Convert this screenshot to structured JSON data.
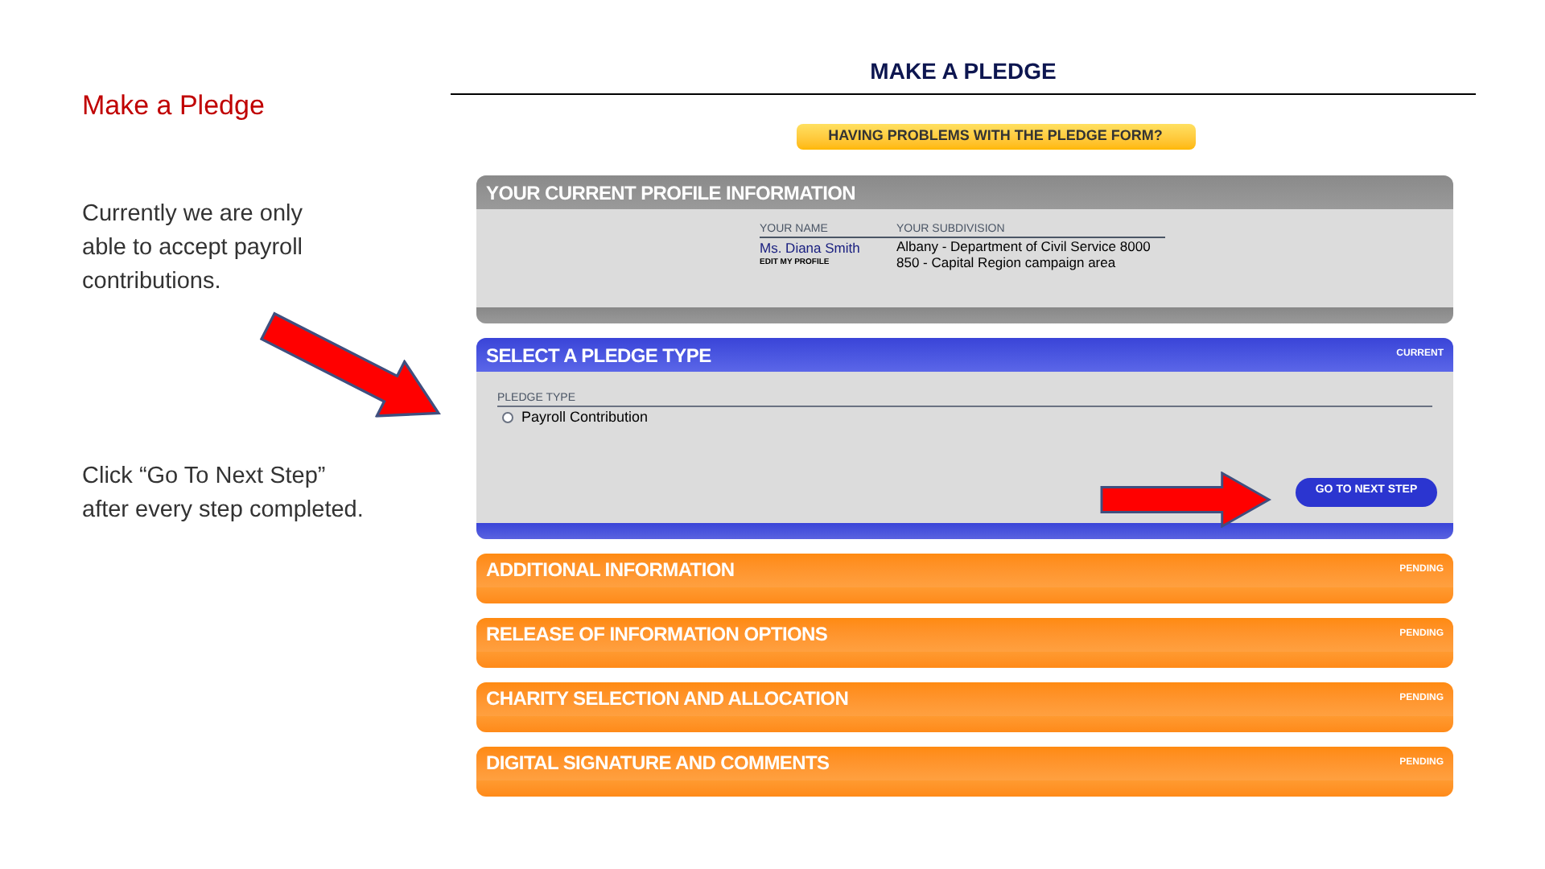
{
  "slide": {
    "title": "Make a Pledge",
    "paragraphs": [
      "Currently we are only able to accept payroll contributions.",
      "Click “Go To Next Step” after every step completed."
    ]
  },
  "page": {
    "heading": "MAKE A PLEDGE",
    "help_button": "HAVING PROBLEMS WITH THE PLEDGE FORM?"
  },
  "profile": {
    "title": "YOUR CURRENT PROFILE INFORMATION",
    "name_label": "YOUR NAME",
    "name": "Ms. Diana Smith",
    "edit_link": "EDIT MY PROFILE",
    "subdivision_label": "YOUR SUBDIVISION",
    "subdivision_lines": [
      "Albany - Department of Civil Service 8000",
      "850 - Capital Region campaign area"
    ]
  },
  "steps": [
    {
      "title": "SELECT A PLEDGE TYPE",
      "status": "CURRENT",
      "kind": "current",
      "field_label": "PLEDGE TYPE",
      "options": [
        {
          "label": "Payroll Contribution",
          "selected": false
        }
      ],
      "next_button": "GO TO NEXT STEP"
    },
    {
      "title": "ADDITIONAL INFORMATION",
      "status": "PENDING",
      "kind": "pending"
    },
    {
      "title": "RELEASE OF INFORMATION OPTIONS",
      "status": "PENDING",
      "kind": "pending"
    },
    {
      "title": "CHARITY SELECTION AND ALLOCATION",
      "status": "PENDING",
      "kind": "pending"
    },
    {
      "title": "DIGITAL SIGNATURE AND COMMENTS",
      "status": "PENDING",
      "kind": "pending"
    }
  ]
}
